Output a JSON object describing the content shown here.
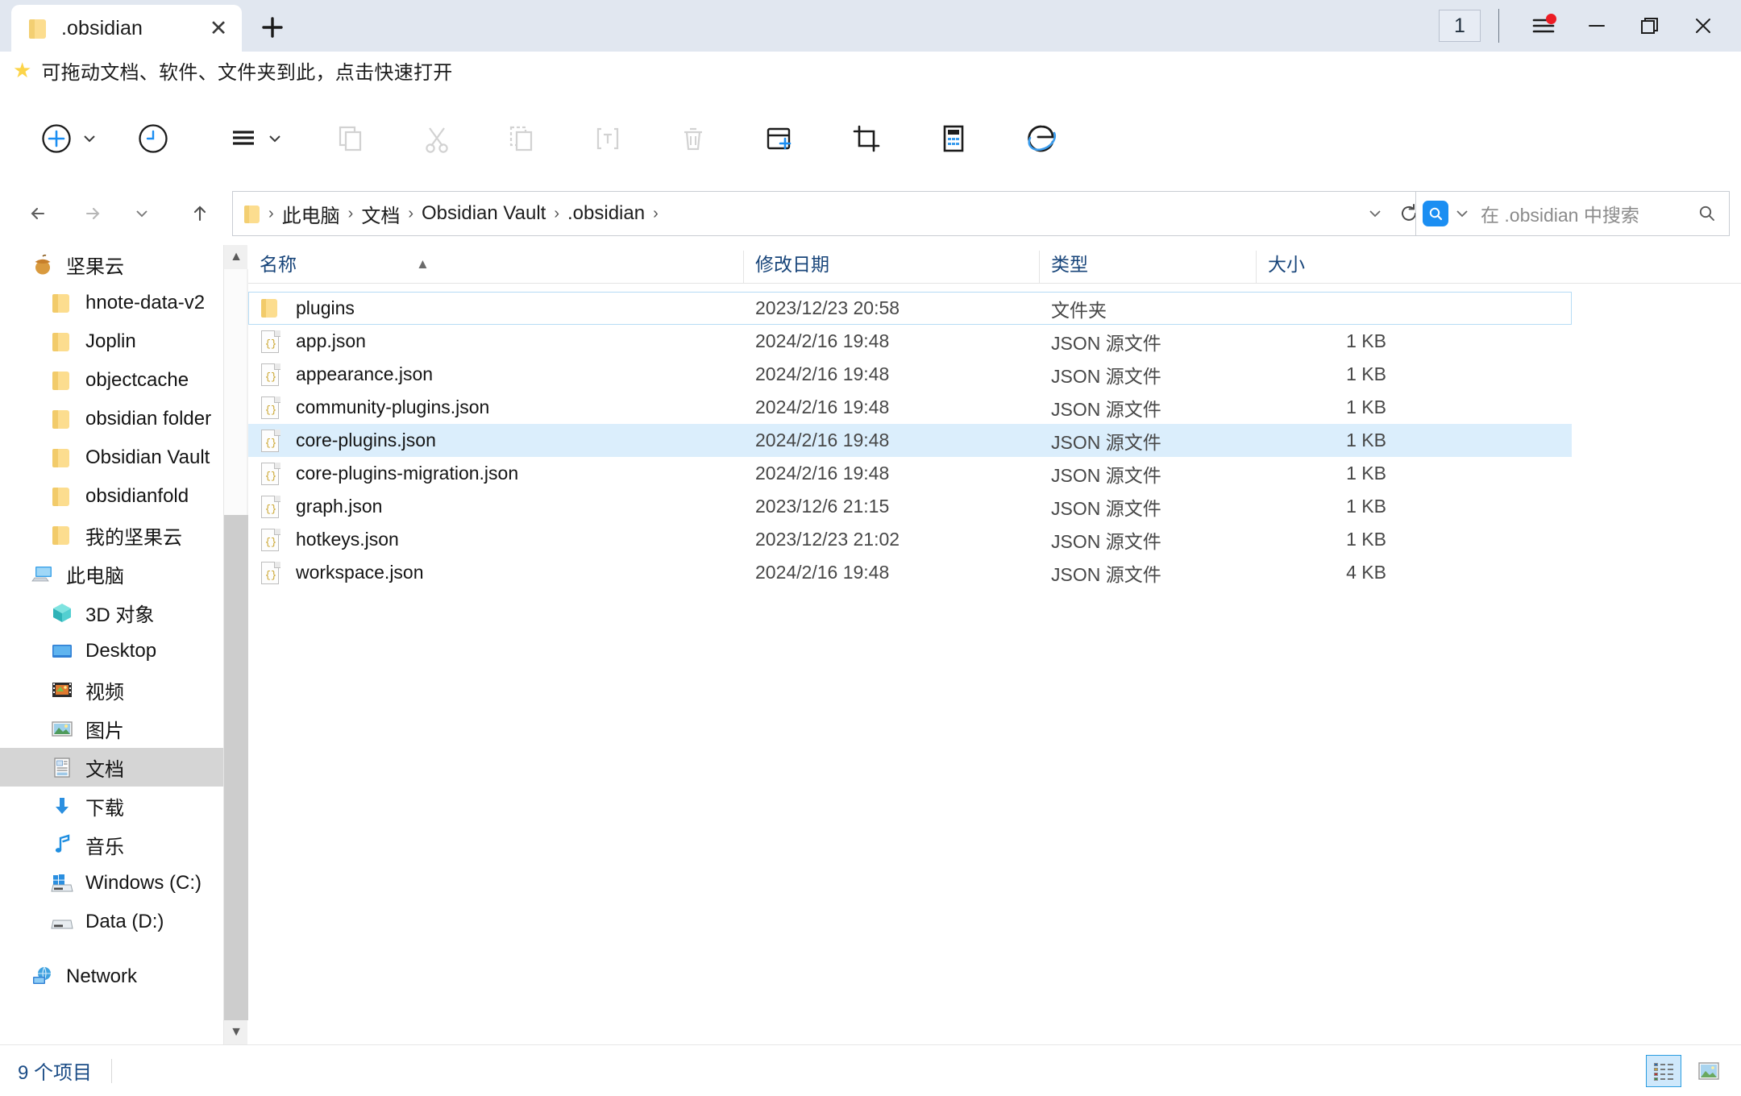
{
  "window": {
    "tab_title": ".obsidian",
    "tab_icon": "folder-icon",
    "close_icon": "close-icon",
    "newtab_icon": "plus-icon",
    "page_count": "1",
    "menu_icon": "hamburger-menu-icon",
    "minimize_icon": "minimize-icon",
    "maximize_icon": "maximize-icon",
    "window_close_icon": "close-icon",
    "accent": "#1b8ef2"
  },
  "favorites": {
    "star_icon": "star-icon",
    "hint": "可拖动文档、软件、文件夹到此，点击快速打开"
  },
  "toolbar": {
    "items": [
      {
        "name": "new-button",
        "icon": "plus-circle-icon",
        "label": "新建",
        "has_chevron": true,
        "enabled": true
      },
      {
        "name": "history-button",
        "icon": "clock-icon",
        "label": "历史记录",
        "has_chevron": false,
        "enabled": true
      },
      {
        "name": "view-menu-button",
        "icon": "list-lines-icon",
        "label": "查看",
        "has_chevron": true,
        "enabled": true
      },
      {
        "name": "copy-button",
        "icon": "copy-icon",
        "label": "复制",
        "has_chevron": false,
        "enabled": false
      },
      {
        "name": "cut-button",
        "icon": "scissors-icon",
        "label": "剪切",
        "has_chevron": false,
        "enabled": false
      },
      {
        "name": "paste-button",
        "icon": "paste-icon",
        "label": "粘贴",
        "has_chevron": false,
        "enabled": false
      },
      {
        "name": "rename-button",
        "icon": "rename-text-icon",
        "label": "重命名",
        "has_chevron": false,
        "enabled": false
      },
      {
        "name": "delete-button",
        "icon": "trash-icon",
        "label": "删除",
        "has_chevron": false,
        "enabled": false
      },
      {
        "name": "new-tab-window-button",
        "icon": "window-plus-icon",
        "label": "新建窗口",
        "has_chevron": false,
        "enabled": true
      },
      {
        "name": "screenshot-button",
        "icon": "crop-icon",
        "label": "截图",
        "has_chevron": false,
        "enabled": true
      },
      {
        "name": "calculator-button",
        "icon": "calculator-icon",
        "label": "计算器",
        "has_chevron": false,
        "enabled": true
      },
      {
        "name": "edge-browser-button",
        "icon": "edge-browser-icon",
        "label": "Edge 浏览器",
        "has_chevron": false,
        "enabled": true
      }
    ]
  },
  "nav": {
    "back_icon": "arrow-left-icon",
    "forward_icon": "arrow-right-icon",
    "recent_icon": "chevron-down-icon",
    "up_icon": "arrow-up-icon",
    "address_folder_icon": "folder-icon",
    "breadcrumbs": [
      "此电脑",
      "文档",
      "Obsidian Vault",
      ".obsidian"
    ],
    "breadcrumb_separator": "›",
    "address_dropdown_icon": "chevron-down-icon",
    "refresh_icon": "refresh-icon"
  },
  "search": {
    "icon": "search-square-icon",
    "dropdown_icon": "chevron-down-icon",
    "placeholder": "在 .obsidian 中搜索",
    "magnifier_icon": "search-icon",
    "value": ""
  },
  "sidebar": {
    "groups": [
      {
        "name": "nutstore",
        "root": {
          "label": "坚果云",
          "icon": "acorn-icon"
        },
        "children": [
          {
            "label": "hnote-data-v2",
            "icon": "folder-icon"
          },
          {
            "label": "Joplin",
            "icon": "folder-icon"
          },
          {
            "label": "objectcache",
            "icon": "folder-icon"
          },
          {
            "label": "obsidian folder",
            "icon": "folder-icon"
          },
          {
            "label": "Obsidian Vault",
            "icon": "folder-icon"
          },
          {
            "label": "obsidianfold",
            "icon": "folder-icon"
          },
          {
            "label": "我的坚果云",
            "icon": "folder-icon"
          }
        ]
      },
      {
        "name": "this-pc",
        "root": {
          "label": "此电脑",
          "icon": "computer-icon"
        },
        "children": [
          {
            "label": "3D 对象",
            "icon": "cube-icon",
            "selected": false
          },
          {
            "label": "Desktop",
            "icon": "desktop-icon",
            "selected": false
          },
          {
            "label": "视频",
            "icon": "video-icon",
            "selected": false
          },
          {
            "label": "图片",
            "icon": "picture-icon",
            "selected": false
          },
          {
            "label": "文档",
            "icon": "document-icon",
            "selected": true
          },
          {
            "label": "下载",
            "icon": "download-icon",
            "selected": false
          },
          {
            "label": "音乐",
            "icon": "music-note-icon",
            "selected": false
          },
          {
            "label": "Windows (C:)",
            "icon": "windows-drive-icon",
            "selected": false
          },
          {
            "label": "Data (D:)",
            "icon": "drive-icon",
            "selected": false
          }
        ]
      },
      {
        "name": "network",
        "root": {
          "label": "Network",
          "icon": "network-icon"
        },
        "children": []
      }
    ],
    "scrollbar": {
      "up_icon": "chevron-up-icon",
      "down_icon": "chevron-down-icon"
    }
  },
  "filelist": {
    "columns": [
      {
        "key": "name",
        "label": "名称",
        "sorted": "asc",
        "sort_icon": "caret-up-icon"
      },
      {
        "key": "date",
        "label": "修改日期",
        "sorted": ""
      },
      {
        "key": "type",
        "label": "类型",
        "sorted": ""
      },
      {
        "key": "size",
        "label": "大小",
        "sorted": ""
      }
    ],
    "rows": [
      {
        "icon": "folder-icon",
        "name": "plugins",
        "date": "2023/12/23 20:58",
        "type": "文件夹",
        "size": "",
        "state": "focus"
      },
      {
        "icon": "json-file-icon",
        "name": "app.json",
        "date": "2024/2/16 19:48",
        "type": "JSON 源文件",
        "size": "1 KB",
        "state": ""
      },
      {
        "icon": "json-file-icon",
        "name": "appearance.json",
        "date": "2024/2/16 19:48",
        "type": "JSON 源文件",
        "size": "1 KB",
        "state": ""
      },
      {
        "icon": "json-file-icon",
        "name": "community-plugins.json",
        "date": "2024/2/16 19:48",
        "type": "JSON 源文件",
        "size": "1 KB",
        "state": ""
      },
      {
        "icon": "json-file-icon",
        "name": "core-plugins.json",
        "date": "2024/2/16 19:48",
        "type": "JSON 源文件",
        "size": "1 KB",
        "state": "selected"
      },
      {
        "icon": "json-file-icon",
        "name": "core-plugins-migration.json",
        "date": "2024/2/16 19:48",
        "type": "JSON 源文件",
        "size": "1 KB",
        "state": ""
      },
      {
        "icon": "json-file-icon",
        "name": "graph.json",
        "date": "2023/12/6 21:15",
        "type": "JSON 源文件",
        "size": "1 KB",
        "state": ""
      },
      {
        "icon": "json-file-icon",
        "name": "hotkeys.json",
        "date": "2023/12/23 21:02",
        "type": "JSON 源文件",
        "size": "1 KB",
        "state": ""
      },
      {
        "icon": "json-file-icon",
        "name": "workspace.json",
        "date": "2024/2/16 19:48",
        "type": "JSON 源文件",
        "size": "4 KB",
        "state": ""
      }
    ]
  },
  "statusbar": {
    "item_count": "9 个项目",
    "views": [
      {
        "name": "details-view-button",
        "icon": "details-list-icon",
        "active": true
      },
      {
        "name": "large-icons-view-button",
        "icon": "large-icons-icon",
        "active": false
      }
    ]
  }
}
